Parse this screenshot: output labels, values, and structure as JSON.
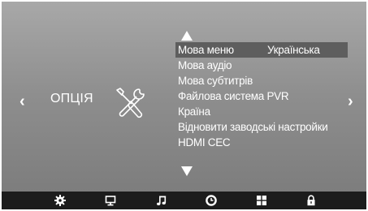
{
  "category": {
    "title": "ОПЦІЯ",
    "icon": "tools-icon"
  },
  "navigation": {
    "left_icon": "chevron-left-icon",
    "right_icon": "chevron-right-icon",
    "up_icon": "triangle-up-icon",
    "down_icon": "triangle-down-icon"
  },
  "menu": {
    "items": [
      {
        "label": "Мова меню",
        "value": "Українська",
        "selected": true
      },
      {
        "label": "Мова аудіо"
      },
      {
        "label": "Мова  субтитрів"
      },
      {
        "label": "Файлова система PVR"
      },
      {
        "label": "Країна"
      },
      {
        "label": "Відновити заводські настройки"
      },
      {
        "label": "HDMI CEC"
      }
    ]
  },
  "tabs": [
    {
      "name": "gear-icon",
      "active": true
    },
    {
      "name": "monitor-icon"
    },
    {
      "name": "music-note-icon"
    },
    {
      "name": "clock-icon"
    },
    {
      "name": "grid-icon"
    },
    {
      "name": "lock-icon"
    }
  ],
  "colors": {
    "background": "#8e8e8e",
    "selected_row": "#5e5e5e",
    "bottom_bar": "#1c1c1c",
    "text": "#ffffff"
  }
}
